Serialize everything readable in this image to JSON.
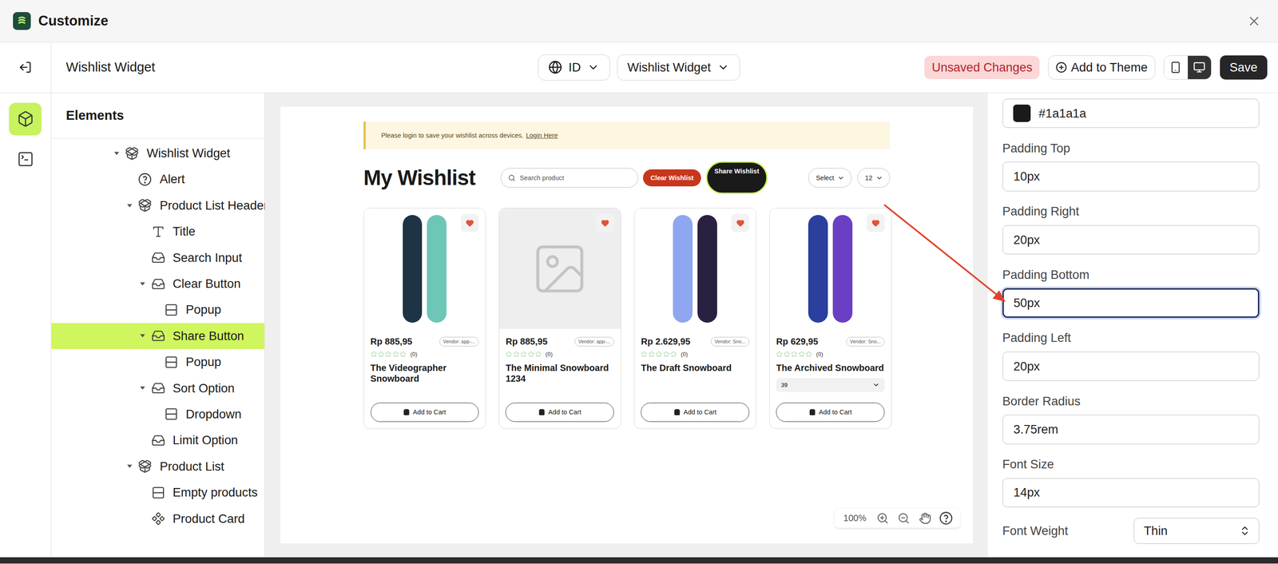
{
  "window": {
    "title": "Customize"
  },
  "toolbar": {
    "title": "Wishlist Widget",
    "language": "ID",
    "template": "Wishlist Widget",
    "status": "Unsaved Changes",
    "add_button": "Add to Theme",
    "devices": [
      {
        "kind": "mobile",
        "selected": false
      },
      {
        "kind": "desktop",
        "selected": true
      }
    ],
    "save_button": "Save"
  },
  "rail": [
    {
      "kind": "elements",
      "selected": true
    },
    {
      "kind": "code",
      "selected": false
    }
  ],
  "elements": {
    "title": "Elements",
    "items": [
      {
        "label": "Wishlist Widget",
        "depth": 0,
        "kind": "widget",
        "expanded": true,
        "selected": false
      },
      {
        "label": "Alert",
        "depth": 1,
        "kind": "alert",
        "selected": false
      },
      {
        "label": "Product List Header",
        "depth": 1,
        "kind": "widget",
        "expanded": true,
        "selected": false
      },
      {
        "label": "Title",
        "depth": 2,
        "kind": "text",
        "selected": false
      },
      {
        "label": "Search Input",
        "depth": 2,
        "kind": "element",
        "selected": false
      },
      {
        "label": "Clear Button",
        "depth": 2,
        "kind": "element",
        "expanded": true,
        "selected": false
      },
      {
        "label": "Popup",
        "depth": 3,
        "kind": "section",
        "selected": false
      },
      {
        "label": "Share Button",
        "depth": 2,
        "kind": "element",
        "expanded": true,
        "selected": true
      },
      {
        "label": "Popup",
        "depth": 3,
        "kind": "section",
        "selected": false
      },
      {
        "label": "Sort Option",
        "depth": 2,
        "kind": "element",
        "expanded": true,
        "selected": false
      },
      {
        "label": "Dropdown",
        "depth": 3,
        "kind": "section",
        "selected": false
      },
      {
        "label": "Limit Option",
        "depth": 2,
        "kind": "element",
        "selected": false
      },
      {
        "label": "Product List",
        "depth": 1,
        "kind": "widget",
        "expanded": true,
        "selected": false
      },
      {
        "label": "Empty products",
        "depth": 2,
        "kind": "section",
        "selected": false
      },
      {
        "label": "Product Card",
        "depth": 2,
        "kind": "card",
        "selected": false
      }
    ]
  },
  "preview": {
    "alert": {
      "text": "Please login to save your wishlist across devices.",
      "link": "Login Here"
    },
    "title": "My Wishlist",
    "search_placeholder": "Search product",
    "clear_button": "Clear Wishlist",
    "share_button": {
      "label": "Share Wishlist",
      "selected": true
    },
    "sort": "Select",
    "limit": "12",
    "products": [
      {
        "price": "Rp 885,95",
        "vendor": "Vendor: app-...",
        "stars": 0,
        "reviews": "(0)",
        "name": "The Videographer Snowboard",
        "kind": "photo",
        "colors": [
          "#1e3444",
          "#6cc7b6"
        ],
        "wishlisted": true,
        "button": "Add to Cart"
      },
      {
        "price": "Rp 885,95",
        "vendor": "Vendor: app-...",
        "stars": 0,
        "reviews": "(0)",
        "name": "The Minimal Snowboard 1234",
        "kind": "placeholder",
        "wishlisted": true,
        "button": "Add to Cart"
      },
      {
        "price": "Rp 2.629,95",
        "vendor": "Vendor: Sno...",
        "stars": 0,
        "reviews": "(0)",
        "name": "The Draft Snowboard",
        "kind": "photo",
        "colors": [
          "#8fa6f0",
          "#2a2140"
        ],
        "wishlisted": true,
        "button": "Add to Cart"
      },
      {
        "price": "Rp 629,95",
        "vendor": "Vendor: Sno...",
        "stars": 0,
        "reviews": "(0)",
        "name": "The Archived Snowboard",
        "kind": "photo",
        "colors": [
          "#2b3f9e",
          "#6a3fc4"
        ],
        "variant": "39",
        "wishlisted": true,
        "button": "Add to Cart"
      }
    ]
  },
  "zoom": {
    "level": "100%"
  },
  "properties": {
    "color": "#1a1a1a",
    "fields": [
      {
        "label": "Padding Top",
        "value": "10px",
        "focused": false
      },
      {
        "label": "Padding Right",
        "value": "20px",
        "focused": false
      },
      {
        "label": "Padding Bottom",
        "value": "50px",
        "focused": true
      },
      {
        "label": "Padding Left",
        "value": "20px",
        "focused": false
      },
      {
        "label": "Border Radius",
        "value": "3.75rem",
        "focused": false
      },
      {
        "label": "Font Size",
        "value": "14px",
        "focused": false
      }
    ],
    "font_weight": {
      "label": "Font Weight",
      "value": "Thin"
    }
  }
}
